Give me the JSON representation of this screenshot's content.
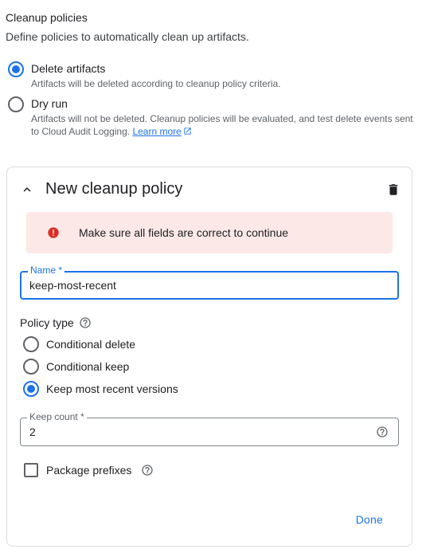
{
  "cleanup": {
    "title": "Cleanup policies",
    "description": "Define policies to automatically clean up artifacts.",
    "modes": [
      {
        "label": "Delete artifacts",
        "help": "Artifacts will be deleted according to cleanup policy criteria.",
        "selected": true
      },
      {
        "label": "Dry run",
        "help": "Artifacts will not be deleted. Cleanup policies will be evaluated, and test delete events sent to Cloud Audit Logging.",
        "link_text": "Learn more",
        "selected": false
      }
    ]
  },
  "policy_card": {
    "title": "New cleanup policy",
    "error_message": "Make sure all fields are correct to continue",
    "name_field": {
      "label": "Name *",
      "value": "keep-most-recent"
    },
    "policy_type_label": "Policy type",
    "policy_types": [
      {
        "label": "Conditional delete",
        "selected": false
      },
      {
        "label": "Conditional keep",
        "selected": false
      },
      {
        "label": "Keep most recent versions",
        "selected": true
      }
    ],
    "keep_count_field": {
      "label": "Keep count *",
      "value": "2"
    },
    "package_prefixes_label": "Package prefixes",
    "package_prefixes_checked": false,
    "done_label": "Done"
  },
  "colors": {
    "accent": "#1a73e8",
    "error": "#d93025",
    "error_bg": "#fce8e6",
    "border": "#dadce0"
  }
}
